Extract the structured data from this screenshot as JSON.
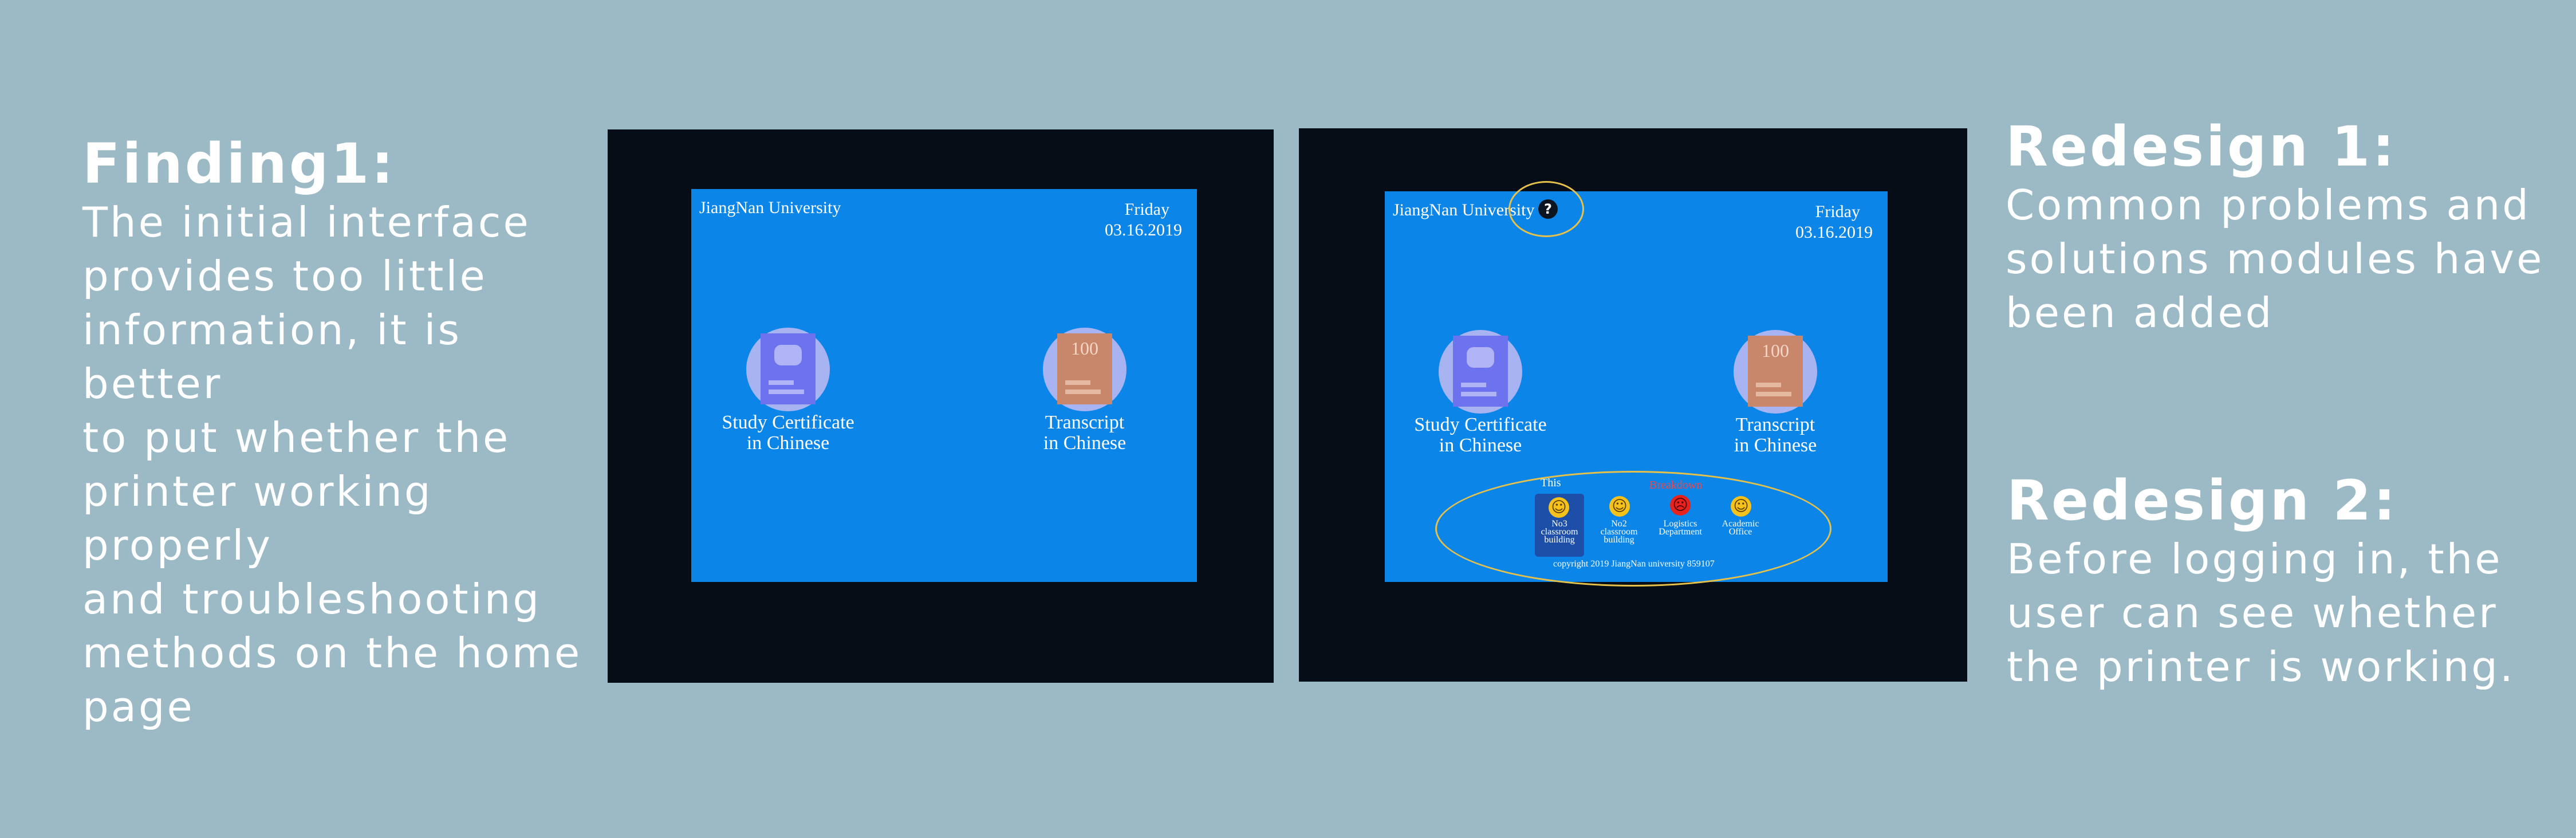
{
  "finding": {
    "title": "Finding1:",
    "body": "The initial interface\n provides too little\n information, it is better\n to put whether the\nprinter working properly\nand troubleshooting\nmethods on the home\npage"
  },
  "redesign1": {
    "title": "Redesign 1:",
    "body": "Common problems and\nsolutions modules have\nbeen added"
  },
  "redesign2": {
    "title": "Redesign 2:",
    "body": "Before logging in, the\nuser can see whether\nthe printer is working."
  },
  "kiosk": {
    "university": "JiangNan University",
    "day": "Friday",
    "date": "03.16.2019",
    "tiles": [
      {
        "line1": "Study Certificate",
        "line2": "in Chinese",
        "icon": "certificate-icon"
      },
      {
        "line1": "Transcript",
        "line2": "in Chinese",
        "icon": "transcript-icon",
        "number": "100"
      }
    ],
    "help_icon": "?",
    "status": {
      "label_this": "This",
      "label_red": "Breakdown",
      "printers": [
        {
          "line1": "No3",
          "line2": "classroom",
          "line3": "building",
          "state": "ok"
        },
        {
          "line1": "No2",
          "line2": "classroom",
          "line3": "building",
          "state": "ok"
        },
        {
          "line1": "Logistics",
          "line2": "Department",
          "line3": "",
          "state": "breakdown"
        },
        {
          "line1": "Academic",
          "line2": "Office",
          "line3": "",
          "state": "ok"
        }
      ],
      "copyright": "copyright 2019 JiangNan university 859107"
    }
  },
  "colors": {
    "background": "#9bbac6",
    "frame": "#060d17",
    "screen": "#0b86e8",
    "highlight": "#e6c14a",
    "ok": "#f4c21a",
    "breakdown": "#e6231c"
  }
}
